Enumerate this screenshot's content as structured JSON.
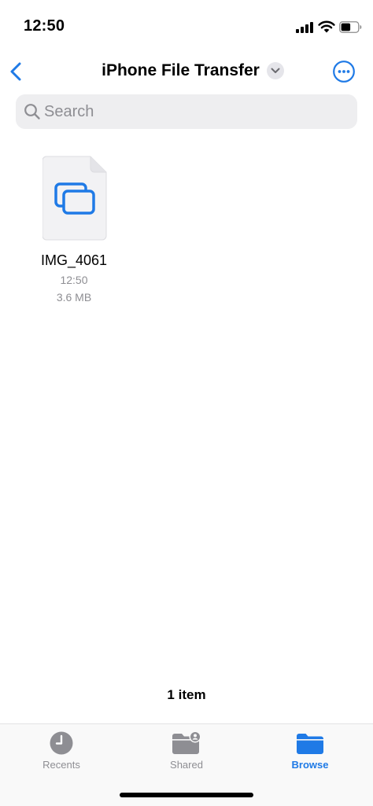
{
  "status_bar": {
    "time": "12:50"
  },
  "nav": {
    "title": "iPhone File Transfer",
    "back_icon": "chevron-left-icon",
    "more_icon": "ellipsis-circle-icon"
  },
  "search": {
    "placeholder": "Search",
    "value": ""
  },
  "files": [
    {
      "name": "IMG_4061",
      "time": "12:50",
      "size": "3.6 MB",
      "icon": "image-stack-icon"
    }
  ],
  "footer": {
    "item_count": "1 item"
  },
  "tabs": [
    {
      "label": "Recents",
      "icon": "clock-icon",
      "active": false
    },
    {
      "label": "Shared",
      "icon": "shared-folder-icon",
      "active": false
    },
    {
      "label": "Browse",
      "icon": "folder-icon",
      "active": true
    }
  ],
  "colors": {
    "accent": "#1f7ae6",
    "inactive": "#8e8e93",
    "search_bg": "#eeeef0"
  }
}
